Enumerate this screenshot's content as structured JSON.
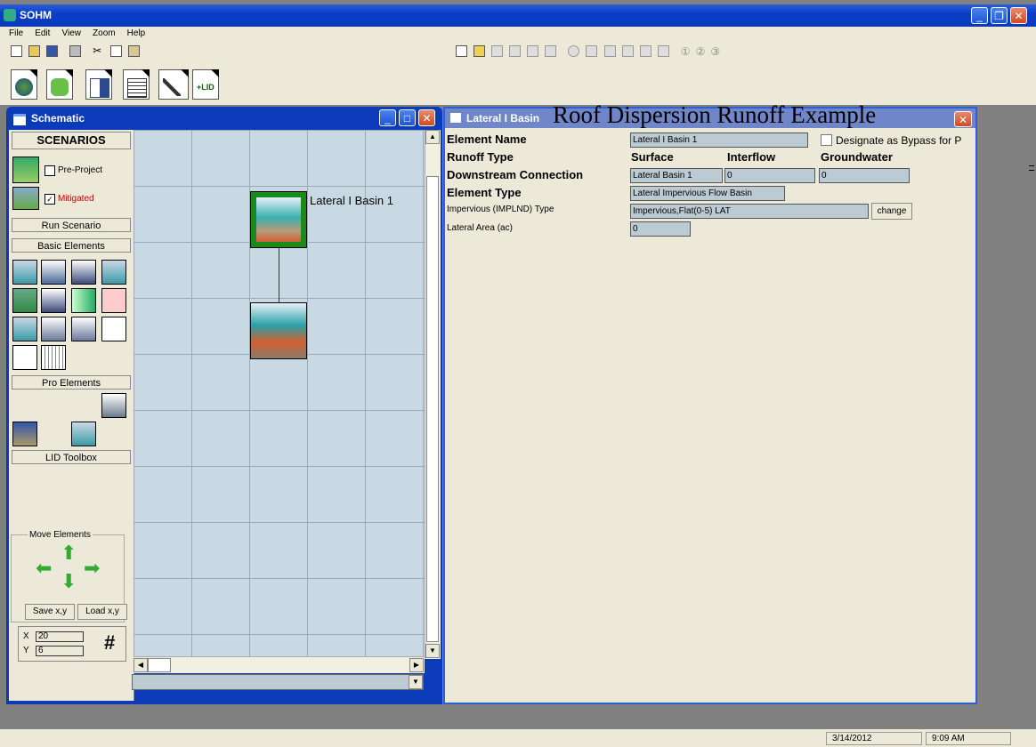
{
  "app": {
    "title": "SOHM"
  },
  "menu": [
    "File",
    "Edit",
    "View",
    "Zoom",
    "Help"
  ],
  "schematic": {
    "title": "Schematic",
    "scenarios_header": "SCENARIOS",
    "scenario_pre": "Pre-Project",
    "scenario_mitigated": "Mitigated",
    "run_scenario": "Run Scenario",
    "basic_elements": "Basic Elements",
    "pro_elements": "Pro Elements",
    "lid_toolbox": "LID Toolbox",
    "move_elements": "Move Elements",
    "save_xy": "Save x,y",
    "load_xy": "Load x,y",
    "x_label": "X",
    "x_value": "20",
    "y_label": "Y",
    "y_value": "6",
    "grid_symbol": "#",
    "node_label": "Lateral I Basin  1"
  },
  "props": {
    "window_title": "Lateral I Basin",
    "overlay_title": "Roof Dispersion Runoff Example",
    "element_name_label": "Element Name",
    "element_name_value": "Lateral I Basin  1",
    "bypass_label": "Designate as Bypass for P",
    "runoff_type_label": "Runoff Type",
    "surface": "Surface",
    "interflow": "Interflow",
    "groundwater": "Groundwater",
    "downstream_label": "Downstream Connection",
    "downstream_surface": "Lateral Basin  1",
    "downstream_interflow": "0",
    "downstream_groundwater": "0",
    "element_type_label": "Element Type",
    "element_type_value": "Lateral Impervious Flow Basin",
    "impervious_label": "Impervious (IMPLND) Type",
    "impervious_value": "Impervious,Flat(0-5) LAT",
    "change_button": "change",
    "lateral_area_label": "Lateral Area (ac)",
    "lateral_area_value": "0"
  },
  "toolbar_numbers": [
    "①",
    "②",
    "③"
  ],
  "status": {
    "date": "3/14/2012",
    "time": "9:09 AM"
  }
}
